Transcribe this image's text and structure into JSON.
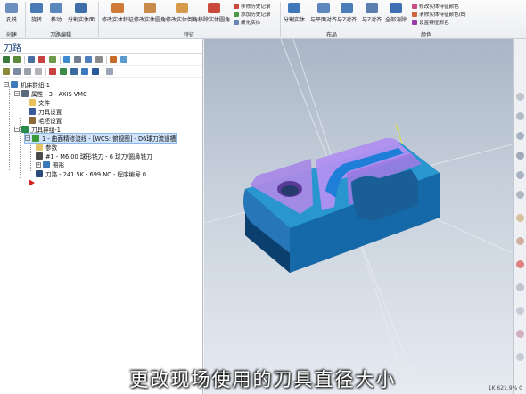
{
  "ribbon": {
    "groups": [
      {
        "label": "创建"
      },
      {
        "label": "刀路编辑"
      },
      {
        "label": "特征"
      },
      {
        "label": "布局"
      },
      {
        "label": "颜色"
      }
    ],
    "buttons": {
      "hole": "孔铣",
      "transform": "旋转",
      "move": "移动",
      "split": "分割实体面",
      "modify_feature": "修改实体特征",
      "modify_fillet": "修改实体圆角",
      "modify_chamfer": "修改实体倒角",
      "remove_fillet": "移除实体圆角",
      "split_solid": "分割实体",
      "align_plane": "与平面对齐",
      "align_z": "与Z对齐",
      "align_z2": "与Z对齐",
      "full_remove": "全部消除"
    },
    "small_items": {
      "remove_history": "移除历史记录",
      "add_history": "添加历史记录",
      "simplify_solid": "简化实体",
      "modify_feature_color": "修改实体特征颜色",
      "remove_feature_color": "清除实体特征颜色(E)",
      "set_feature_color": "设置特征颜色"
    }
  },
  "panel": {
    "title": "刀路"
  },
  "tree": {
    "machine_group": "机床群组-1",
    "properties": "属性 - 3 - AXIS VMC",
    "files": "文件",
    "tool_settings": "刀具设置",
    "stock_settings": "毛坯设置",
    "toolpath_group": "刀具群组-1",
    "operation": "1 - 曲面精修流线 - [WCS: 俯视图] - D6球刀流道槽",
    "params": "参数",
    "tool": "#1 - M6.00 球形铣刀 - 6 球刀/圆鼻铣刀",
    "geometry": "图形",
    "toolpath": "刀路 - 241.5K - 699.NC - 程序编号 0"
  },
  "subtitle": "更改现场使用的刀具直径大小",
  "status": "1K 621.9% 0",
  "colors": {
    "part_body": "#1566a6",
    "part_top": "#2a9ad2",
    "path_purple": "#b08ae8",
    "selection": "#cfe3fb"
  }
}
